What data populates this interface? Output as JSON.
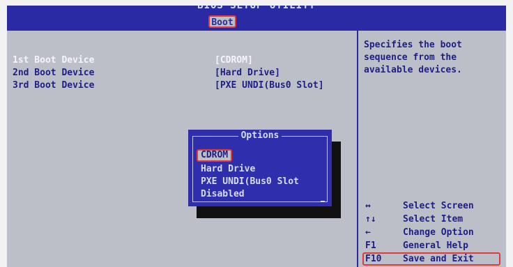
{
  "header": {
    "title": "BIOS SETUP UTILITY",
    "active_tab": "Boot"
  },
  "boot_settings": [
    {
      "label": "1st Boot Device",
      "value": "[CDROM]"
    },
    {
      "label": "2nd Boot Device",
      "value": "[Hard Drive]"
    },
    {
      "label": "3rd Boot Device",
      "value": "[PXE UNDI(Bus0 Slot]"
    }
  ],
  "help_text": "Specifies the boot\nsequence from the\navailable devices.",
  "options_popup": {
    "title": "Options",
    "items": [
      "CDROM",
      "Hard Drive",
      "PXE UNDI(Bus0 Slot",
      "Disabled"
    ]
  },
  "key_legend": [
    {
      "key": "↔",
      "desc": "Select Screen"
    },
    {
      "key": "↑↓",
      "desc": "Select Item"
    },
    {
      "key": "←",
      "desc": "Change Option"
    },
    {
      "key": "F1",
      "desc": "General Help"
    },
    {
      "key": "F10",
      "desc": "Save and Exit"
    }
  ],
  "colors": {
    "header_blue": "#2a2aa4",
    "panel_gray": "#bdbfc8",
    "text_navy": "#1e1e86",
    "highlight_red": "#e03a3a"
  }
}
